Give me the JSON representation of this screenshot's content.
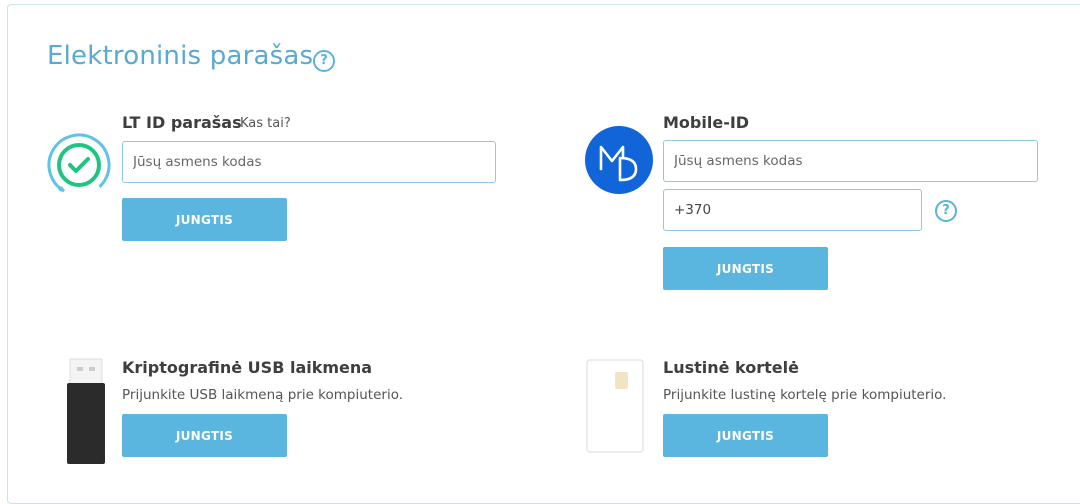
{
  "page": {
    "title": "Elektroninis parašas",
    "help_icon": "question-circle-icon"
  },
  "ltid": {
    "heading": "LT ID parašas",
    "link": "Kas tai?",
    "icon": "lt-id-check-icon",
    "personal_code_placeholder": "Jūsų asmens kodas",
    "button": "JUNGTIS"
  },
  "mobile_id": {
    "heading": "Mobile-ID",
    "icon": "mobile-id-logo",
    "personal_code_placeholder": "Jūsų asmens kodas",
    "phone_value": "+370",
    "help_icon": "question-circle-icon",
    "button": "JUNGTIS"
  },
  "usb": {
    "heading": "Kriptografinė USB laikmena",
    "description": "Prijunkite USB laikmeną prie kompiuterio.",
    "icon": "usb-token-icon",
    "button": "JUNGTIS"
  },
  "smartcard": {
    "heading": "Lustinė kortelė",
    "description": "Prijunkite lustinę kortelę prie kompiuterio.",
    "icon": "smart-card-icon",
    "button": "JUNGTIS"
  },
  "colors": {
    "accent": "#5ab6de",
    "title": "#59a9d0",
    "ltid_green": "#1fc481",
    "mobile_blue": "#1265d8"
  }
}
